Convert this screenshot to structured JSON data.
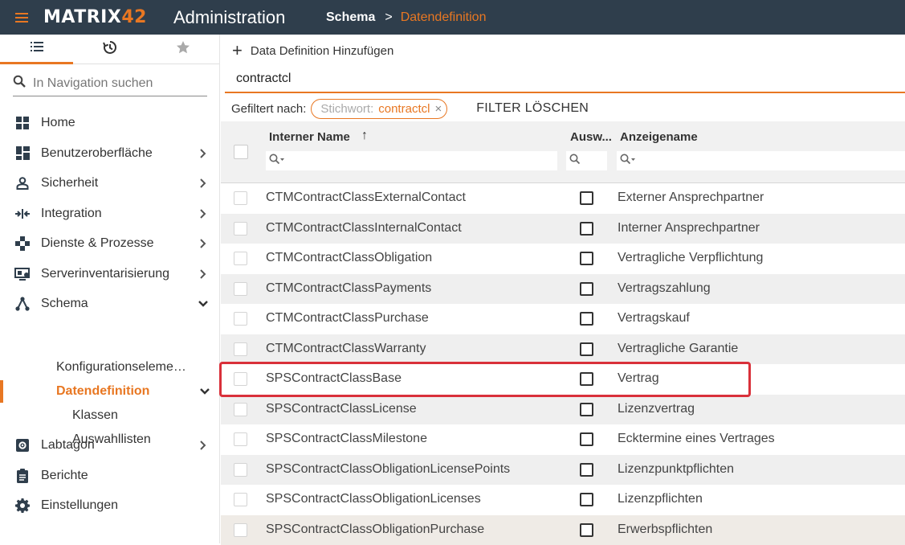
{
  "topbar": {
    "logo_text": "MATRIX",
    "logo_num": "42",
    "app_title": "Administration",
    "breadcrumb": {
      "parent": "Schema",
      "separator": ">",
      "current": "Datendefinition"
    },
    "accent_color": "#e87722",
    "bar_color": "#2f3e4c"
  },
  "sidebar": {
    "tabs": [
      {
        "icon": "list-icon",
        "active": true
      },
      {
        "icon": "history-icon",
        "active": false
      },
      {
        "icon": "star-icon",
        "active": false
      }
    ],
    "search": {
      "placeholder": "In Navigation suchen"
    },
    "items": [
      {
        "label": "Home",
        "icon": "home-grid-icon",
        "chevron": "none"
      },
      {
        "label": "Benutzeroberfläche",
        "icon": "dashboard-icon",
        "chevron": "right"
      },
      {
        "label": "Sicherheit",
        "icon": "person-icon",
        "chevron": "right"
      },
      {
        "label": "Integration",
        "icon": "integration-arrows-icon",
        "chevron": "right"
      },
      {
        "label": "Dienste & Prozesse",
        "icon": "workflow-icon",
        "chevron": "right"
      },
      {
        "label": "Serverinventarisierung",
        "icon": "server-inventory-icon",
        "chevron": "right"
      },
      {
        "label": "Schema",
        "icon": "schema-icon",
        "chevron": "down"
      },
      {
        "label": "Labtagon",
        "icon": "gear-box-icon",
        "chevron": "right"
      },
      {
        "label": "Berichte",
        "icon": "clipboard-icon",
        "chevron": "none"
      },
      {
        "label": "Einstellungen",
        "icon": "gear-icon",
        "chevron": "none"
      }
    ],
    "schema_children": [
      {
        "label": "Konfigurationselemente",
        "label_display": "Konfigurationseleme…"
      },
      {
        "label": "Datendefinition",
        "active": true
      },
      {
        "label": "Klassen"
      },
      {
        "label": "Auswahllisten"
      }
    ]
  },
  "main": {
    "add_button": {
      "label": "Data Definition Hinzufügen"
    },
    "filter_input": {
      "value": "contractcl"
    },
    "filtered_by_label": "Gefiltert nach:",
    "chip": {
      "key": "Stichwort:",
      "value": "contractcl",
      "close": "×"
    },
    "clear_filter_label": "FILTER LÖSCHEN",
    "columns": {
      "internal_name": "Interner Name",
      "selection": "Ausw...",
      "display_name": "Anzeigename",
      "sort_indicator": "↑"
    },
    "rows": [
      {
        "internal_name": "CTMContractClassExternalContact",
        "display_name": "Externer Ansprechpartner"
      },
      {
        "internal_name": "CTMContractClassInternalContact",
        "display_name": "Interner Ansprechpartner"
      },
      {
        "internal_name": "CTMContractClassObligation",
        "display_name": "Vertragliche Verpflichtung"
      },
      {
        "internal_name": "CTMContractClassPayments",
        "display_name": "Vertragszahlung"
      },
      {
        "internal_name": "CTMContractClassPurchase",
        "display_name": "Vertragskauf"
      },
      {
        "internal_name": "CTMContractClassWarranty",
        "display_name": "Vertragliche Garantie"
      },
      {
        "internal_name": "SPSContractClassBase",
        "display_name": "Vertrag",
        "highlighted": true
      },
      {
        "internal_name": "SPSContractClassLicense",
        "display_name": "Lizenzvertrag"
      },
      {
        "internal_name": "SPSContractClassMilestone",
        "display_name": "Ecktermine eines Vertrages"
      },
      {
        "internal_name": "SPSContractClassObligationLicensePoints",
        "display_name": "Lizenzpunktpflichten"
      },
      {
        "internal_name": "SPSContractClassObligationLicenses",
        "display_name": "Lizenzpflichten"
      },
      {
        "internal_name": "SPSContractClassObligationPurchase",
        "display_name": "Erwerbspflichten"
      }
    ],
    "highlight_color": "#d9303a"
  }
}
